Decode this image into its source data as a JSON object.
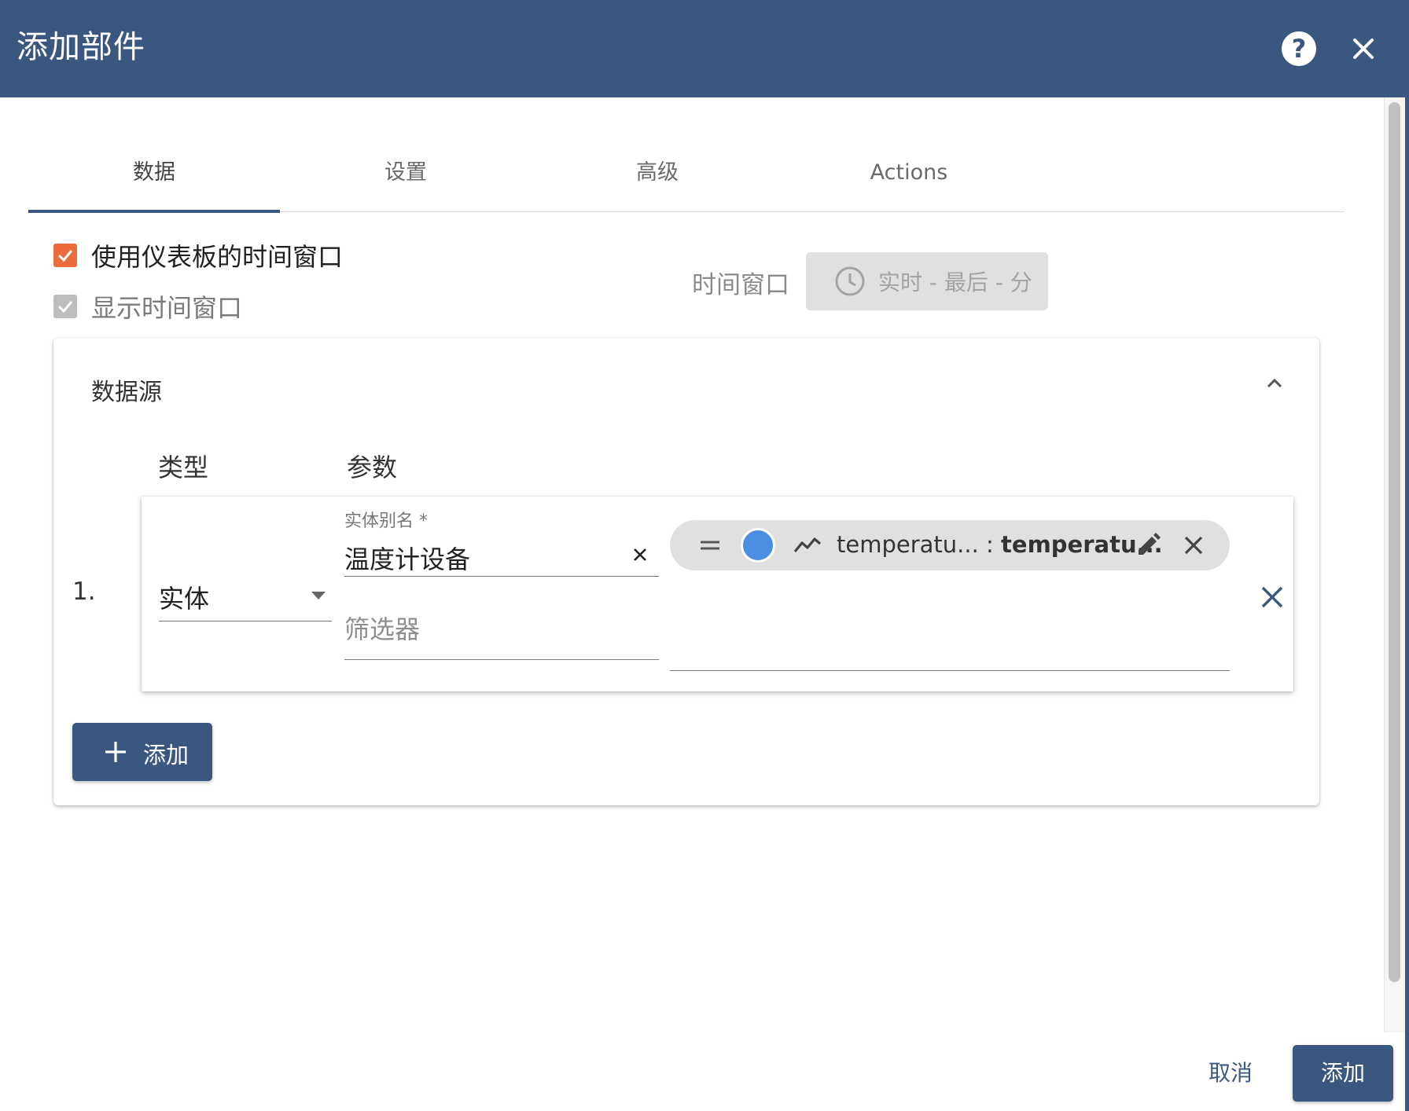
{
  "header": {
    "title": "添加部件",
    "help_icon": "help-circle-icon",
    "close_icon": "close-icon"
  },
  "tabs": [
    {
      "label": "数据",
      "active": true
    },
    {
      "label": "设置",
      "active": false
    },
    {
      "label": "高级",
      "active": false
    },
    {
      "label": "Actions",
      "active": false
    }
  ],
  "options": {
    "use_dashboard_timewindow": {
      "label": "使用仪表板的时间窗口",
      "checked": true
    },
    "display_timewindow": {
      "label": "显示时间窗口",
      "checked": true,
      "disabled": true
    }
  },
  "timewindow": {
    "label": "时间窗口",
    "value": "实时 - 最后 - 分",
    "icon": "clock-icon"
  },
  "datasources": {
    "title": "数据源",
    "columns": {
      "type": "类型",
      "params": "参数"
    },
    "rows": [
      {
        "index": "1.",
        "type": "实体",
        "alias_label": "实体别名 *",
        "alias_value": "温度计设备",
        "filter_placeholder": "筛选器",
        "key": {
          "color": "#4a8ee4",
          "label_part": "temperatu...",
          "separator": " : ",
          "name_part": "temperatu..."
        }
      }
    ],
    "add_label": "添加"
  },
  "footer": {
    "cancel_label": "取消",
    "submit_label": "添加"
  },
  "colors": {
    "primary": "#3a587f",
    "accent": "#ea6b3c"
  }
}
